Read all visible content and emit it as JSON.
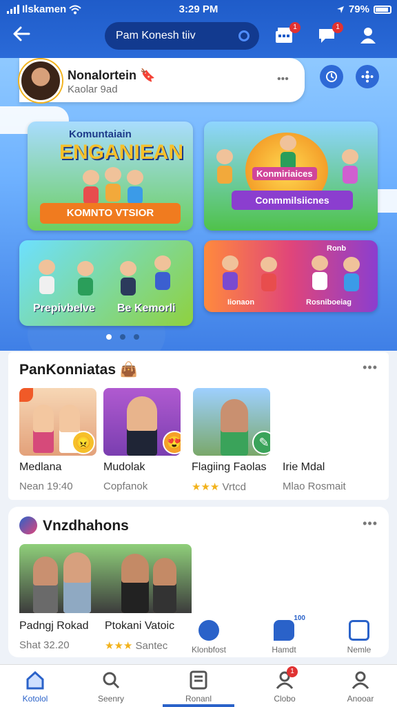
{
  "status_bar": {
    "carrier": "Ilskamen",
    "time": "3:29 PM",
    "battery": "79%"
  },
  "header": {
    "search_text": "Pam Konesh tiiv",
    "cart_badge": "1",
    "chat_badge": "1"
  },
  "profile": {
    "name": "Nonalortein",
    "emoji": "🔖",
    "subtitle": "Kaolar 9ad",
    "more": "•••"
  },
  "hero_cards": [
    {
      "title": "Komuntaiain",
      "big": "ENGANIEAN",
      "banner": "KOMNTO VTSIOR"
    },
    {
      "title": "Konmiriaices",
      "banner": "Conmmilsiicnes"
    },
    {
      "title": "Prepivbelve",
      "title2": "Be Kemorli"
    },
    {
      "title": "Iionaon",
      "title2": "Rosniboeiag",
      "sticker": "Ronb"
    }
  ],
  "section1": {
    "title": "PanKonniatas",
    "emoji": "👜",
    "more": "•••",
    "items": [
      {
        "name": "Medlana",
        "sub": "Nean 19:40"
      },
      {
        "name": "Mudolak",
        "sub": "Copfanok"
      },
      {
        "name": "Flagiing Faolas",
        "sub": "Vrtcd",
        "stars": "★★★"
      },
      {
        "name": "Irie Mdal",
        "sub": "Mlao Rosmait"
      }
    ]
  },
  "section2": {
    "title": "Vnzdhahons",
    "more": "•••",
    "video": {
      "title": "Padngj Rokad",
      "sub": "Shat 32.20"
    },
    "video2": {
      "title": "Ptokani Vatoic",
      "sub": "Santec",
      "stars": "★★★"
    },
    "actions": [
      {
        "label": "Klonbfost",
        "icon": "camera-icon"
      },
      {
        "label": "Hamdt",
        "icon": "chat-bubble-icon",
        "badge": "100"
      },
      {
        "label": "Nemle",
        "icon": "grid-icon"
      }
    ]
  },
  "bottom_nav": [
    {
      "label": "Kotolol",
      "icon": "home-icon"
    },
    {
      "label": "Seenry",
      "icon": "search-icon"
    },
    {
      "label": "Ronanl",
      "icon": "document-icon"
    },
    {
      "label": "Clobo",
      "icon": "profile-icon",
      "badge": "1"
    },
    {
      "label": "Anooar",
      "icon": "user-icon"
    }
  ],
  "colors": {
    "brand": "#2a62c9",
    "header": "#1f5cc9",
    "badge": "#e03232"
  }
}
